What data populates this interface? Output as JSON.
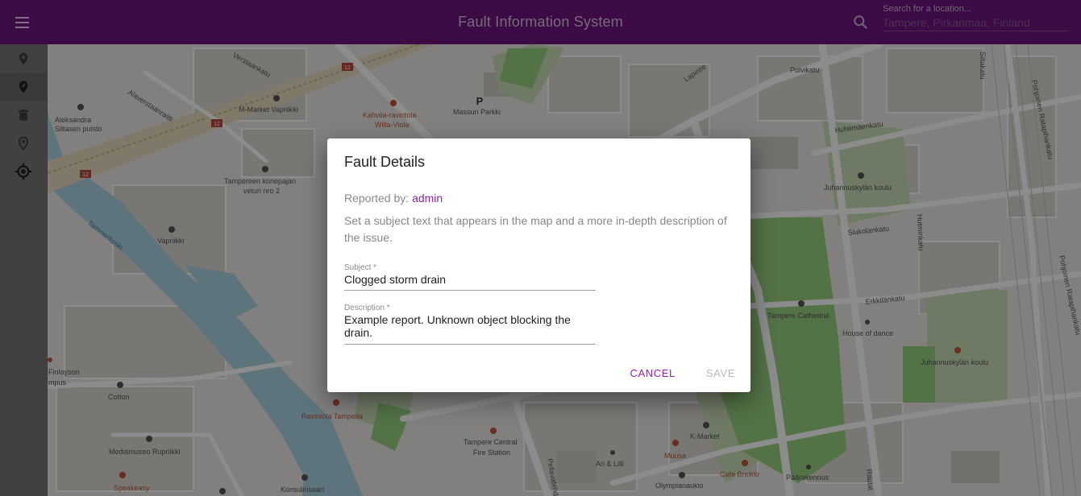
{
  "app": {
    "title": "Fault Information System",
    "accent_color": "#6e1480"
  },
  "search": {
    "label": "Search for a location...",
    "value": "Tampere, Pirkanmaa, Finland"
  },
  "sidebar": {
    "tools": [
      {
        "icon": "map-pin-add-icon",
        "active": false
      },
      {
        "icon": "map-pin-edit-icon",
        "active": true
      },
      {
        "icon": "trash-icon",
        "active": false
      },
      {
        "icon": "map-pin-outline-icon",
        "active": false
      },
      {
        "icon": "my-location-icon",
        "active": false
      }
    ]
  },
  "map": {
    "labels": {
      "verstaankatu": "Verstaankatu",
      "alaverstaanraitti": "Alaverstaanraitti",
      "m_market": "M-Market Vapriikki",
      "kahvila1": "Kahvila-ravintola",
      "kahvila2": "Willa-Viola",
      "massun": "Massun Parkki",
      "lapintie": "Lapintie",
      "polvikatu": "Polvikatu",
      "sittakatu": "Siltakatu",
      "pohjoinen1": "Pohjoinen Ratapihankatu",
      "pohjoinen2": "Pohjoinen Ratapihankatu",
      "huhtimaenkatu": "Huhtimäenkatu",
      "aleksandra1": "Aleksandra",
      "aleksandra2": "Siltasen puisto",
      "konepaja1": "Tampereen konepajan",
      "konepaja2": "veturi nro 2",
      "juhannuskyla_koulu_top": "Juhannuskylän koulu",
      "hutminkatu": "Hutminkatu",
      "siukolankatu": "Siukolankatu",
      "tammerkoski": "Tammerkoski",
      "vapriikki": "Vapriikki",
      "erkkilankatu": "Erkkilänkatu",
      "cathedral": "Tampere Cathedral",
      "house_of_dance": "House of dance",
      "juhannuskyla_koulu": "Juhannuskylän koulu",
      "finlayson1": "Finlayson",
      "finlayson2": "mpus",
      "cotton": "Cotton",
      "tampella": "Ravintola Tampella",
      "fire1": "Tampere Central",
      "fire2": "Fire Station",
      "kmarket": "K-Market",
      "mediamuseo": "Mediamuseo Rupriikki",
      "ari": "Ari & Lilli",
      "muusa": "Muusa",
      "cafe": "Cafe Breikki",
      "paarakennus": "Päärakennus",
      "speakeasy": "Speakeasy",
      "konsulinsaari": "Konsulinsaari",
      "olympianaukio": "Olympianaukio",
      "pellavatehdas": "Pellavatehdas",
      "rautatienkatu": "Rautat",
      "road_12a": "12",
      "road_12b": "12",
      "road_12c": "12",
      "road_12d": "12",
      "parking": "P"
    }
  },
  "dialog": {
    "title": "Fault Details",
    "reported_prefix": "Reported by:",
    "reported_user": "admin",
    "help_text": "Set a subject text that appears in the map and a more in-depth description of the issue.",
    "subject_label": "Subject *",
    "subject_value": "Clogged storm drain",
    "description_label": "Description *",
    "description_value": "Example report. Unknown object blocking the drain.",
    "cancel_label": "CANCEL",
    "save_label": "SAVE"
  }
}
